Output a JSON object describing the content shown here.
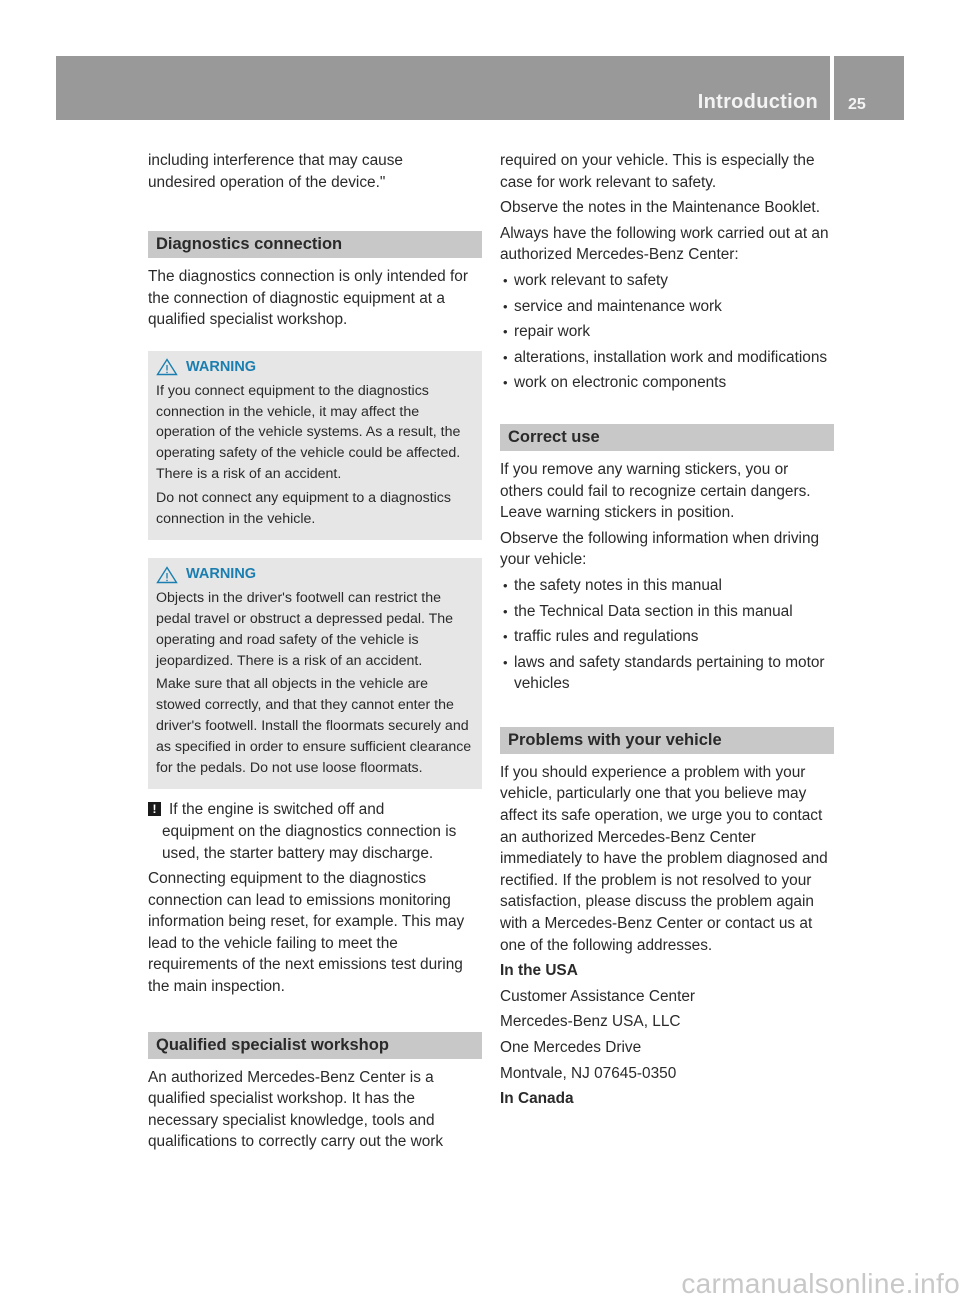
{
  "header": {
    "title": "Introduction",
    "page_number": "25"
  },
  "left": {
    "intro_lines": [
      "including interference that may cause",
      "undesired operation of the device.\""
    ],
    "diagnostics": {
      "heading": "Diagnostics connection",
      "body": "The diagnostics connection is only intended for the connection of diagnostic equipment at a qualified specialist workshop.",
      "warning1": {
        "label": "WARNING",
        "p1": "If you connect equipment to the diagnostics connection in the vehicle, it may affect the operation of the vehicle systems. As a result, the operating safety of the vehicle could be affected. There is a risk of an accident.",
        "p2": "Do not connect any equipment to a diagnostics connection in the vehicle."
      },
      "warning2": {
        "label": "WARNING",
        "p1": "Objects in the driver's footwell can restrict the pedal travel or obstruct a depressed pedal. The operating and road safety of the vehicle is jeopardized. There is a risk of an accident.",
        "p2": "Make sure that all objects in the vehicle are stowed correctly, and that they cannot enter the driver's footwell. Install the floormats securely and as specified in order to ensure sufficient clearance for the pedals. Do not use loose floormats."
      },
      "note": {
        "icon": "!",
        "line1": "If the engine is switched off and",
        "rest": "equipment on the diagnostics connection is used, the starter battery may discharge."
      },
      "body2": "Connecting equipment to the diagnostics connection can lead to emissions monitoring information being reset, for example. This may lead to the vehicle failing to meet the requirements of the next emissions test during the main inspection."
    },
    "workshop": {
      "heading": "Qualified specialist workshop",
      "body": "An authorized Mercedes-Benz Center is a qualified specialist workshop. It has the necessary specialist knowledge, tools and qualifications to correctly carry out the work"
    }
  },
  "right": {
    "cont": "required on your vehicle. This is especially the case for work relevant to safety.",
    "maintenance": "Observe the notes in the Maintenance Booklet.",
    "always": "Always have the following work carried out at an authorized Mercedes-Benz Center:",
    "work_items": [
      "work relevant to safety",
      "service and maintenance work",
      "repair work",
      "alterations, installation work and modifications",
      "work on electronic components"
    ],
    "correct_use": {
      "heading": "Correct use",
      "p1": "If you remove any warning stickers, you or others could fail to recognize certain dangers. Leave warning stickers in position.",
      "p2": "Observe the following information when driving your vehicle:",
      "items": [
        "the safety notes in this manual",
        "the Technical Data section in this manual",
        "traffic rules and regulations",
        "laws and safety standards pertaining to motor vehicles"
      ]
    },
    "problems": {
      "heading": "Problems with your vehicle",
      "body": "If you should experience a problem with your vehicle, particularly one that you believe may affect its safe operation, we urge you to contact an authorized Mercedes-Benz Center immediately to have the problem diagnosed and rectified. If the problem is not resolved to your satisfaction, please discuss the problem again with a Mercedes-Benz Center or contact us at one of the following addresses.",
      "usa_label": "In the USA",
      "usa_address": [
        "Customer Assistance Center",
        "Mercedes-Benz USA, LLC",
        "One Mercedes Drive",
        "Montvale, NJ 07645-0350"
      ],
      "canada_label": "In Canada"
    }
  },
  "watermark": "carmanualsonline.info",
  "colors": {
    "header_bg": "#999999",
    "section_bg": "#c8c8c8",
    "warning_bg": "#e6e6e6",
    "warning_accent": "#1a7fb0"
  }
}
